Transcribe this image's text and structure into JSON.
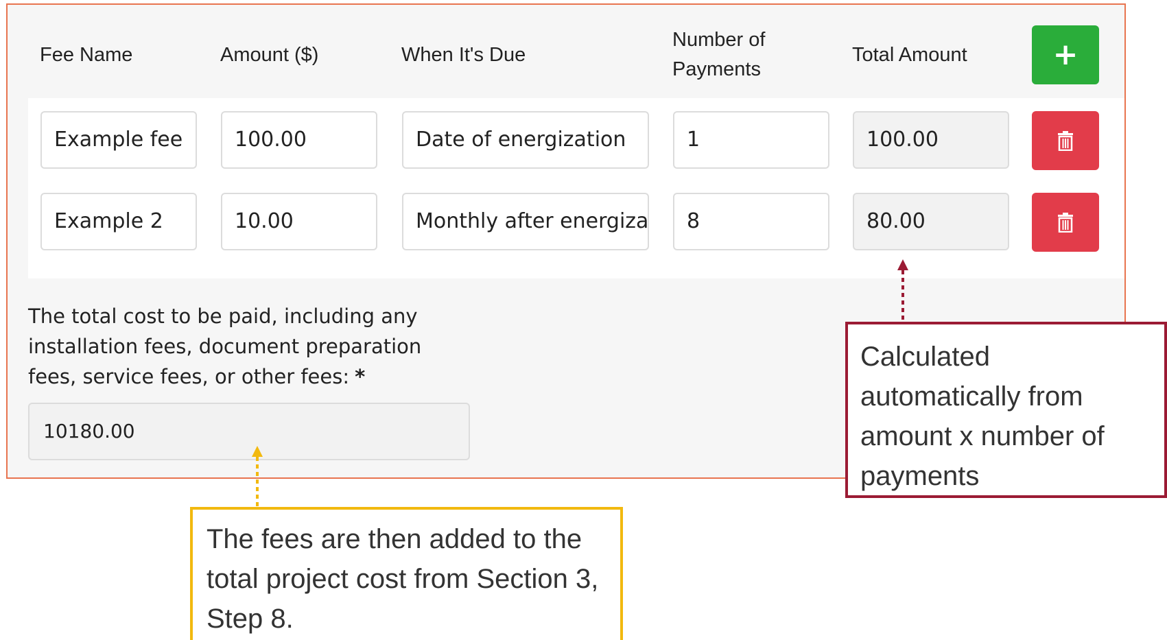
{
  "table": {
    "headers": {
      "fee_name": "Fee Name",
      "amount": "Amount ($)",
      "when_due": "When It's Due",
      "num_payments_line1": "Number of",
      "num_payments_line2": "Payments",
      "total_amount": "Total Amount"
    },
    "add_button_icon": "plus-icon",
    "rows": [
      {
        "fee_name": "Example fee",
        "amount": "100.00",
        "when_due": "Date of energization",
        "num_payments": "1",
        "total": "100.00",
        "delete_icon": "trash-icon"
      },
      {
        "fee_name": "Example 2",
        "amount": "10.00",
        "when_due": "Monthly after energization",
        "num_payments": "8",
        "total": "80.00",
        "delete_icon": "trash-icon"
      }
    ]
  },
  "total_cost": {
    "label": "The total cost to be paid, including any installation fees, document preparation fees, service fees, or other fees:",
    "required_marker": "*",
    "value": "10180.00"
  },
  "callouts": {
    "calculated": "Calculated automatically from amount x number of payments",
    "fees_added": "The fees are then added to the total project cost from Section 3, Step 8."
  },
  "colors": {
    "panel_border": "#e8744f",
    "add_button": "#2aad3a",
    "delete_button": "#e23c4a",
    "callout_red": "#9b1b34",
    "callout_yellow": "#f2b90f"
  }
}
